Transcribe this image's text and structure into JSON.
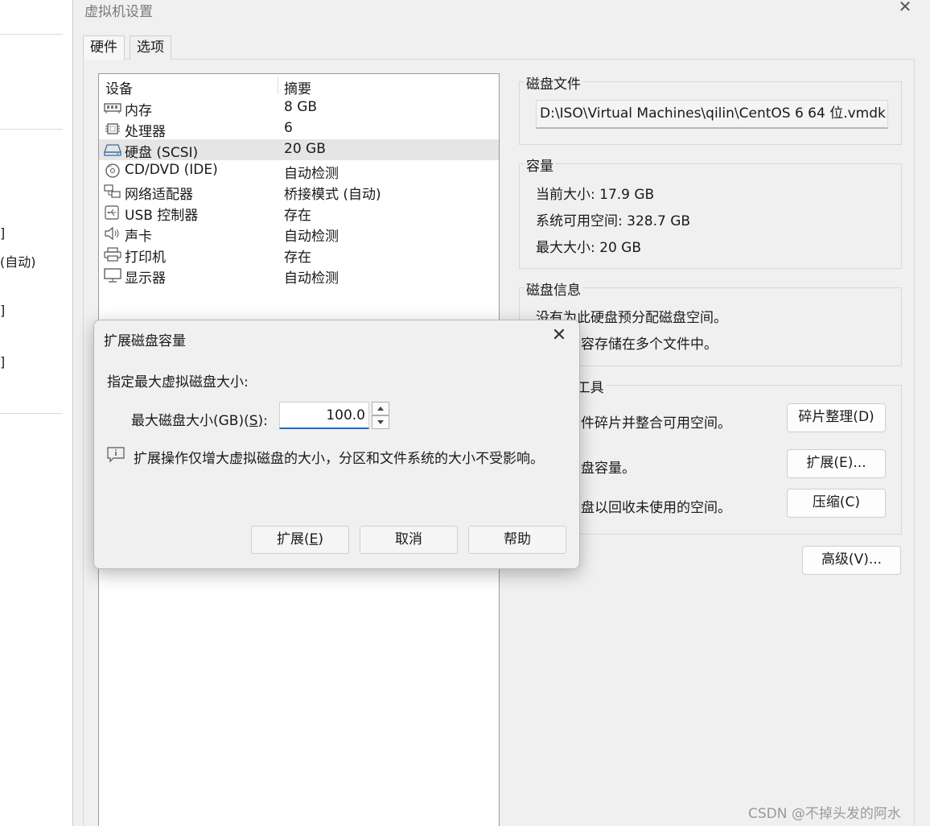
{
  "background_app": {
    "fragments": [
      "]",
      "(自动)",
      "]",
      "]"
    ]
  },
  "window": {
    "title": "虚拟机设置",
    "tabs": [
      {
        "label": "硬件"
      },
      {
        "label": "选项"
      }
    ]
  },
  "device_list": {
    "headers": {
      "device": "设备",
      "summary": "摘要"
    },
    "rows": [
      {
        "icon": "memory-icon",
        "name": "内存",
        "summary": "8 GB"
      },
      {
        "icon": "processor-icon",
        "name": "处理器",
        "summary": "6"
      },
      {
        "icon": "hard-disk-icon",
        "name": "硬盘 (SCSI)",
        "summary": "20 GB"
      },
      {
        "icon": "cd-dvd-icon",
        "name": "CD/DVD (IDE)",
        "summary": "自动检测"
      },
      {
        "icon": "network-adapter-icon",
        "name": "网络适配器",
        "summary": "桥接模式 (自动)"
      },
      {
        "icon": "usb-icon",
        "name": "USB 控制器",
        "summary": "存在"
      },
      {
        "icon": "sound-card-icon",
        "name": "声卡",
        "summary": "自动检测"
      },
      {
        "icon": "printer-icon",
        "name": "打印机",
        "summary": "存在"
      },
      {
        "icon": "display-icon",
        "name": "显示器",
        "summary": "自动检测"
      }
    ]
  },
  "disk_file": {
    "title": "磁盘文件",
    "path": "D:\\ISO\\Virtual Machines\\qilin\\CentOS 6 64 位.vmdk"
  },
  "capacity": {
    "title": "容量",
    "current_size": "当前大小: 17.9 GB",
    "available_space": "系统可用空间: 328.7 GB",
    "max_size": "最大大小: 20 GB"
  },
  "disk_info": {
    "title": "磁盘信息",
    "line1": "没有为此硬盘预分配磁盘空间。",
    "line2": "容存储在多个文件中。"
  },
  "tools": {
    "title": "]工具",
    "defrag_desc": "件碎片并整合可用空间。",
    "defrag_button": "碎片整理(D)",
    "expand_desc": "盘容量。",
    "expand_button": "扩展(E)...",
    "compact_desc": "盘以回收未使用的空间。",
    "compact_button": "压缩(C)"
  },
  "advanced_button": "高级(V)...",
  "dialog": {
    "title": "扩展磁盘容量",
    "instruction": "指定最大虚拟磁盘大小:",
    "field_label_prefix": "最大磁盘大小(GB)(",
    "field_label_hotkey": "S",
    "field_label_suffix": "):",
    "field_value": "100.0",
    "info_text": "扩展操作仅增大虚拟磁盘的大小，分区和文件系统的大小不受影响。",
    "buttons": {
      "expand_prefix": "扩展(",
      "expand_hotkey": "E",
      "expand_suffix": ")",
      "cancel": "取消",
      "help": "帮助"
    }
  },
  "watermark": "CSDN @不掉头发的阿水",
  "colors": {
    "window_bg": "#f0f0f0",
    "selection_bg": "#e5e5e5",
    "focus_underline": "#1a6fc9"
  }
}
